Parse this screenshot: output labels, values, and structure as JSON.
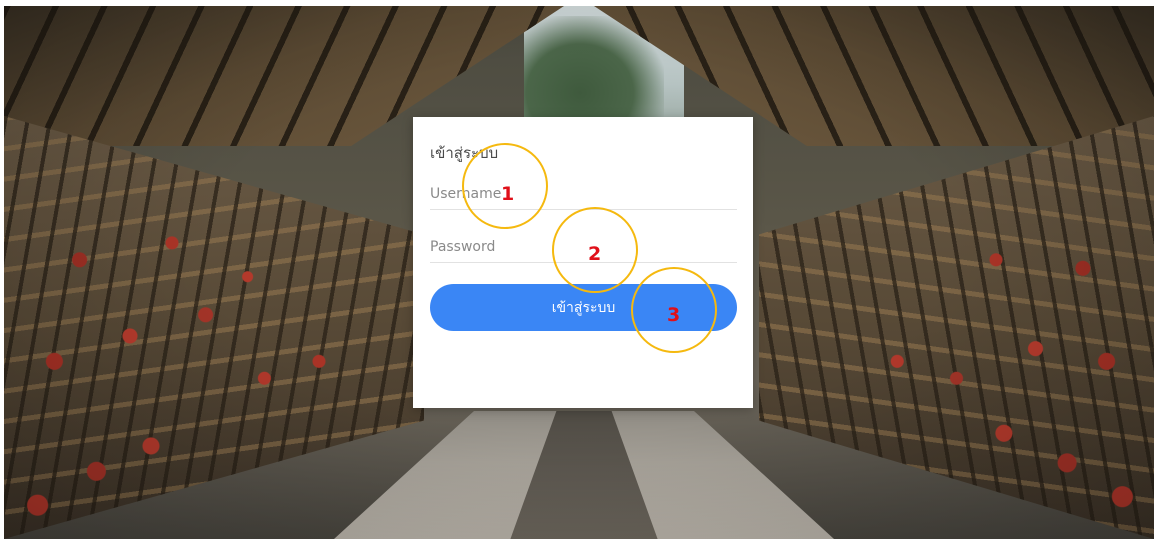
{
  "login": {
    "title": "เข้าสู่ระบบ",
    "username_placeholder": "Username",
    "password_placeholder": "Password",
    "submit_label": "เข้าสู่ระบบ"
  },
  "annotations": {
    "step1": "1",
    "step2": "2",
    "step3": "3",
    "circle_color": "#f5b90f",
    "number_color": "#e0101a"
  },
  "colors": {
    "button_bg": "#3a86f5",
    "card_bg": "#ffffff"
  }
}
